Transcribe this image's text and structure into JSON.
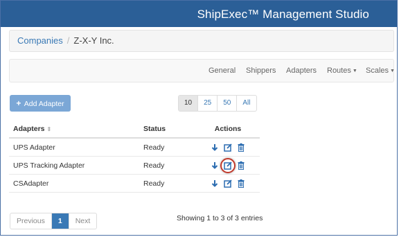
{
  "app": {
    "title": "ShipExec™ Management Studio"
  },
  "breadcrumb": {
    "parent": "Companies",
    "separator": "/",
    "current": "Z-X-Y Inc."
  },
  "nav": {
    "general": "General",
    "shippers": "Shippers",
    "adapters": "Adapters",
    "routes": "Routes",
    "scales": "Scales"
  },
  "toolbar": {
    "add_label": "Add Adapter"
  },
  "page_size": {
    "options": [
      "10",
      "25",
      "50",
      "All"
    ],
    "selected": "10"
  },
  "table": {
    "columns": {
      "name": "Adapters",
      "status": "Status",
      "actions": "Actions"
    },
    "rows": [
      {
        "name": "UPS Adapter",
        "status": "Ready"
      },
      {
        "name": "UPS Tracking Adapter",
        "status": "Ready"
      },
      {
        "name": "CSAdapter",
        "status": "Ready"
      }
    ]
  },
  "pagination": {
    "previous": "Previous",
    "current": "1",
    "next": "Next"
  },
  "info": {
    "entries": "Showing 1 to 3 of 3 entries"
  },
  "colors": {
    "brand": "#2b5f97",
    "link": "#3a79b5",
    "button": "#7ba7d6",
    "highlight": "#c0392b"
  }
}
